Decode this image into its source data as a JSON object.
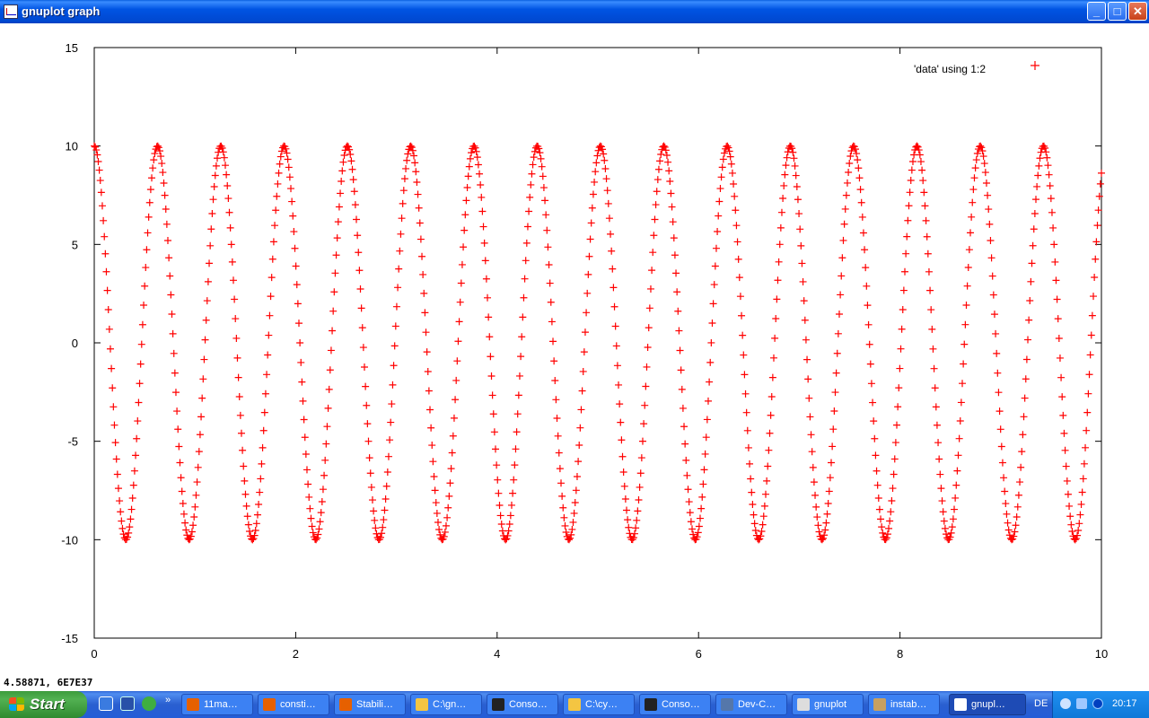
{
  "window": {
    "title": "gnuplot graph",
    "controls": {
      "minimize": "_",
      "maximize": "□",
      "close": "✕"
    }
  },
  "status_readout": "4.58871, 6E7E37",
  "chart_data": {
    "type": "scatter",
    "marker": "+",
    "color": "#ff0000",
    "xlim": [
      0,
      10
    ],
    "ylim": [
      -15,
      15
    ],
    "x_ticks": [
      "0",
      "2",
      "4",
      "6",
      "8",
      "10"
    ],
    "y_ticks": [
      "15",
      "10",
      "5",
      "0",
      "-5",
      "-10",
      "-15"
    ],
    "grid": false,
    "legend_position": "top-right",
    "series": [
      {
        "name": "'data' using 1:2",
        "function": "10*cos(10*x)",
        "x_start": 0,
        "x_end": 10,
        "n_points": 1000
      }
    ]
  },
  "taskbar": {
    "start_label": "Start",
    "more": "»",
    "buttons": [
      {
        "label": "11ma…",
        "icon": "firefox-icon",
        "color": "#e66000"
      },
      {
        "label": "consti…",
        "icon": "firefox-icon",
        "color": "#e66000"
      },
      {
        "label": "Stabili…",
        "icon": "firefox-icon",
        "color": "#e66000"
      },
      {
        "label": "C:\\gn…",
        "icon": "folder-icon",
        "color": "#f4c542"
      },
      {
        "label": "Conso…",
        "icon": "console-icon",
        "color": "#222222"
      },
      {
        "label": "C:\\cy…",
        "icon": "folder-icon",
        "color": "#f4c542"
      },
      {
        "label": "Conso…",
        "icon": "console-icon",
        "color": "#222222"
      },
      {
        "label": "Dev-C…",
        "icon": "devcpp-icon",
        "color": "#5577aa"
      },
      {
        "label": "gnuplot",
        "icon": "gnuplot-icon",
        "color": "#dddddd"
      },
      {
        "label": "instab…",
        "icon": "document-icon",
        "color": "#c8a060"
      },
      {
        "label": "gnupl…",
        "icon": "gnuplot-graph-icon",
        "color": "#ffffff",
        "active": true
      }
    ],
    "language": "DE",
    "clock": "20:17"
  }
}
